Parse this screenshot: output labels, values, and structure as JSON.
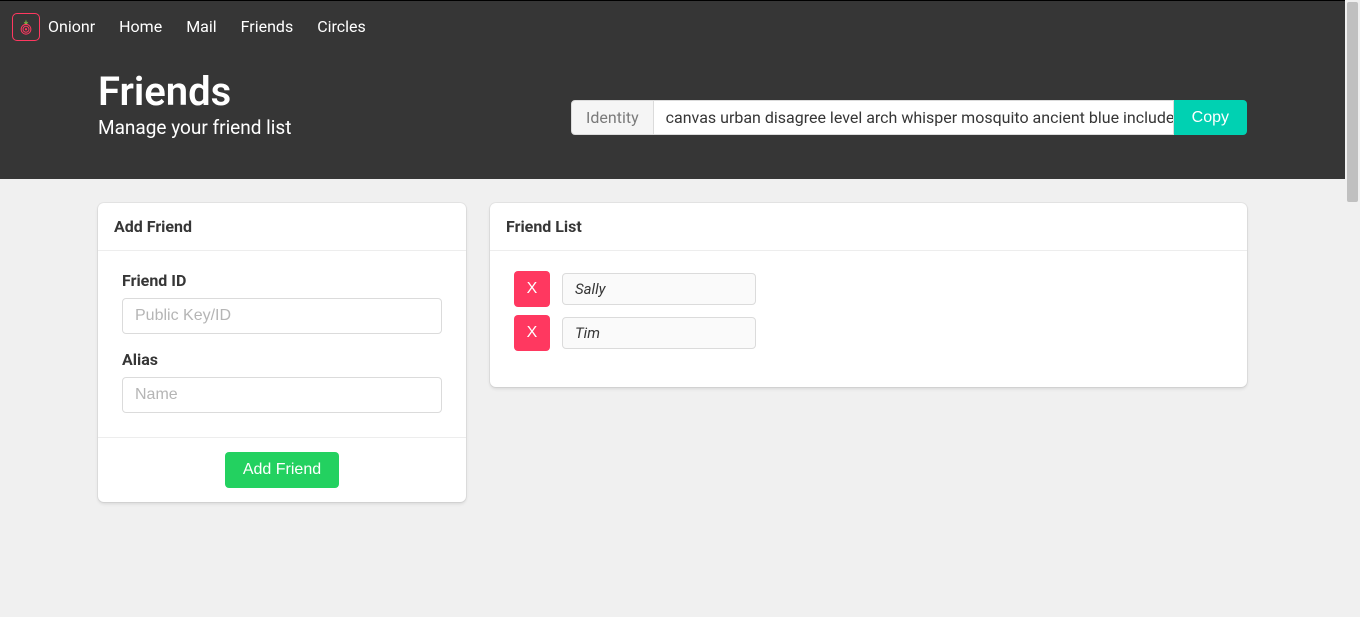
{
  "brand": {
    "name": "Onionr"
  },
  "nav": {
    "items": [
      {
        "label": "Home"
      },
      {
        "label": "Mail"
      },
      {
        "label": "Friends"
      },
      {
        "label": "Circles"
      }
    ]
  },
  "header": {
    "title": "Friends",
    "subtitle": "Manage your friend list"
  },
  "identity": {
    "label": "Identity",
    "value": "canvas urban disagree level arch whisper mosquito ancient blue include",
    "copy_label": "Copy"
  },
  "add_friend": {
    "card_title": "Add Friend",
    "friend_id_label": "Friend ID",
    "friend_id_placeholder": "Public Key/ID",
    "friend_id_value": "",
    "alias_label": "Alias",
    "alias_placeholder": "Name",
    "alias_value": "",
    "button_label": "Add Friend"
  },
  "friend_list": {
    "card_title": "Friend List",
    "delete_label": "X",
    "friends": [
      {
        "name": "Sally"
      },
      {
        "name": "Tim"
      }
    ]
  },
  "colors": {
    "primary": "#00d1b2",
    "danger": "#ff3860",
    "success": "#23d160",
    "dark": "#363636"
  }
}
